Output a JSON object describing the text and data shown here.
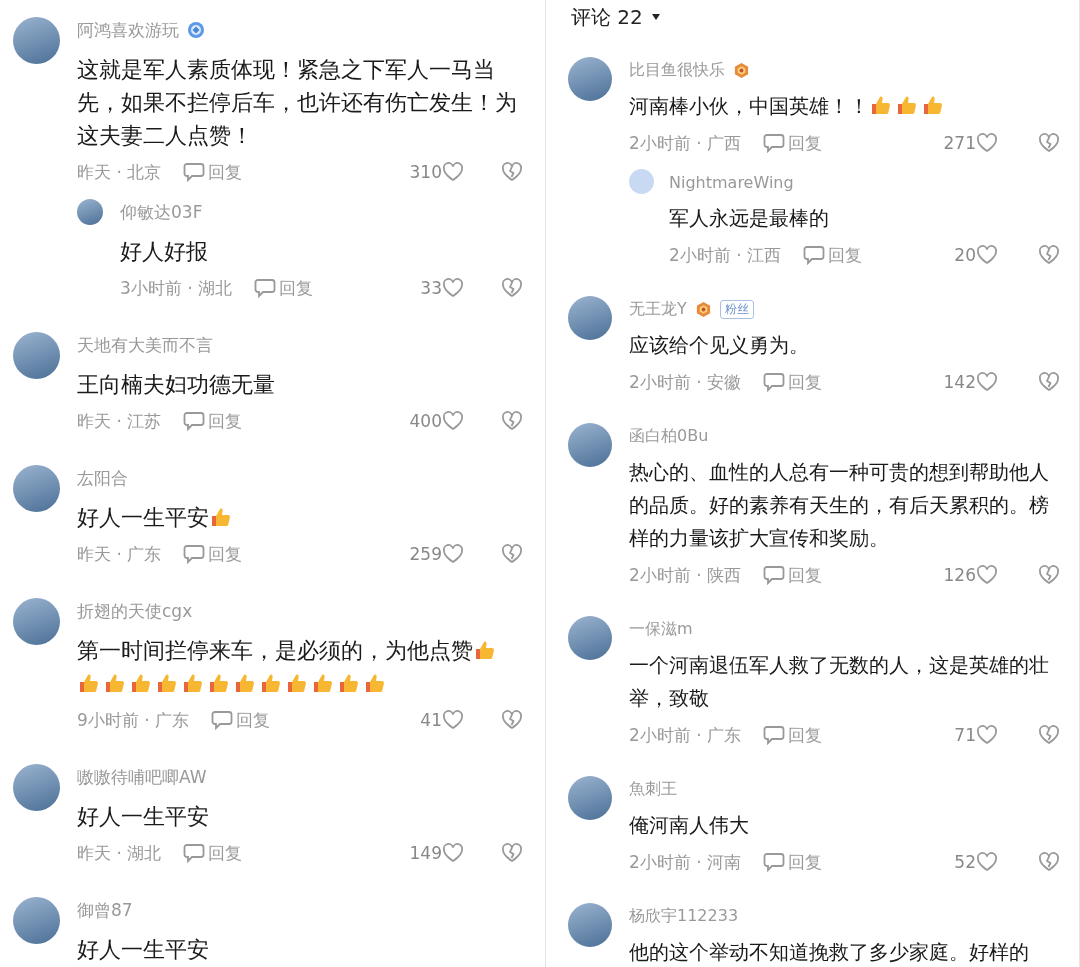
{
  "panels": [
    {
      "comments": [
        {
          "user": "阿鸿喜欢游玩",
          "badges": [
            {
              "kind": "verified"
            }
          ],
          "text": "这就是军人素质体现！紧急之下军人一马当先，如果不拦停后车，也许还有伤亡发生！为这夫妻二人点赞！",
          "time": "昨天 · 北京",
          "reply_label": "回复",
          "likes": "310",
          "replies": [
            {
              "user": "仰敏达03F",
              "text": "好人好报",
              "time": "3小时前 · 湖北",
              "reply_label": "回复",
              "likes": "33"
            }
          ]
        },
        {
          "user": "天地有大美而不言",
          "text": "王向楠夫妇功德无量",
          "time": "昨天 · 江苏",
          "reply_label": "回复",
          "likes": "400"
        },
        {
          "user": "厷阳合",
          "text": "好人一生平安",
          "emoji": [
            {
              "kind": "thumbs-up"
            }
          ],
          "time": "昨天 · 广东",
          "reply_label": "回复",
          "likes": "259"
        },
        {
          "user": "折翅的天使cgx",
          "text": "第一时间拦停来车，是必须的，为他点赞",
          "emoji": [
            {
              "kind": "thumbs-up"
            },
            {
              "kind": "thumbs-up"
            },
            {
              "kind": "thumbs-up"
            },
            {
              "kind": "thumbs-up"
            },
            {
              "kind": "thumbs-up"
            },
            {
              "kind": "thumbs-up"
            },
            {
              "kind": "thumbs-up"
            },
            {
              "kind": "thumbs-up"
            },
            {
              "kind": "thumbs-up"
            },
            {
              "kind": "thumbs-up"
            },
            {
              "kind": "thumbs-up"
            },
            {
              "kind": "thumbs-up"
            },
            {
              "kind": "thumbs-up"
            }
          ],
          "time": "9小时前 · 广东",
          "reply_label": "回复",
          "likes": "41"
        },
        {
          "user": "嗷嗷待哺吧唧AW",
          "text": "好人一生平安",
          "time": "昨天 · 湖北",
          "reply_label": "回复",
          "likes": "149"
        },
        {
          "user": "御曾87",
          "text": "好人一生平安"
        }
      ]
    },
    {
      "header": {
        "label": "评论 22"
      },
      "comments": [
        {
          "user": "比目鱼很快乐",
          "badges": [
            {
              "kind": "medal"
            }
          ],
          "text": "河南棒小伙，中国英雄！！",
          "emoji": [
            {
              "kind": "thumbs-up"
            },
            {
              "kind": "thumbs-up"
            },
            {
              "kind": "thumbs-up"
            }
          ],
          "time": "2小时前 · 广西",
          "reply_label": "回复",
          "likes": "271",
          "replies": [
            {
              "user": "NightmareWing",
              "text": "军人永远是最棒的",
              "time": "2小时前 · 江西",
              "reply_label": "回复",
              "likes": "20"
            }
          ]
        },
        {
          "user": "无王龙Y",
          "badges": [
            {
              "kind": "medal"
            },
            {
              "kind": "tag",
              "label": "粉丝"
            }
          ],
          "text": "应该给个见义勇为。",
          "time": "2小时前 · 安徽",
          "reply_label": "回复",
          "likes": "142"
        },
        {
          "user": "函白柏0Bu",
          "text": "热心的、血性的人总有一种可贵的想到帮助他人的品质。好的素养有天生的，有后天累积的。榜样的力量该扩大宣传和奖励。",
          "time": "2小时前 · 陕西",
          "reply_label": "回复",
          "likes": "126"
        },
        {
          "user": "一保滋m",
          "text": "一个河南退伍军人救了无数的人，这是英雄的壮举，致敬",
          "time": "2小时前 · 广东",
          "reply_label": "回复",
          "likes": "71"
        },
        {
          "user": "魚刺王",
          "text": "俺河南人伟大",
          "time": "2小时前 · 河南",
          "reply_label": "回复",
          "likes": "52"
        },
        {
          "user": "杨欣宇112233",
          "text": "他的这个举动不知道挽救了多少家庭。好样的"
        }
      ]
    }
  ]
}
